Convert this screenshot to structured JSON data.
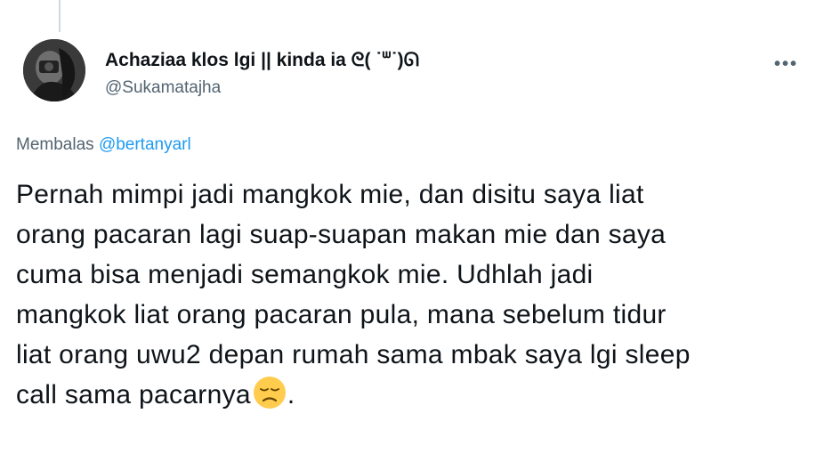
{
  "tweet": {
    "author": {
      "display_name": "Achaziaa klos lgi || kinda ia ᘓ( ˙ᐜ˙)ᘏ",
      "handle": "@Sukamatajha"
    },
    "more_label": "•••",
    "reply": {
      "prefix": "Membalas",
      "mention": "@bertanyarl"
    },
    "text_lines": [
      "Pernah mimpi jadi mangkok mie, dan disitu saya liat",
      "orang pacaran lagi suap-suapan makan mie dan saya",
      "cuma bisa menjadi semangkok mie. Udhlah jadi",
      "mangkok liat orang pacaran pula, mana sebelum tidur",
      "liat orang uwu2 depan rumah sama mbak saya lgi sleep"
    ],
    "last_line_text": "call sama pacarnya",
    "last_line_suffix": ".",
    "emoji": "disappointed-face-icon"
  },
  "colors": {
    "text": "#0f1419",
    "secondary": "#536471",
    "link": "#1d9bf0",
    "emoji_face": "#ffcc4d"
  }
}
